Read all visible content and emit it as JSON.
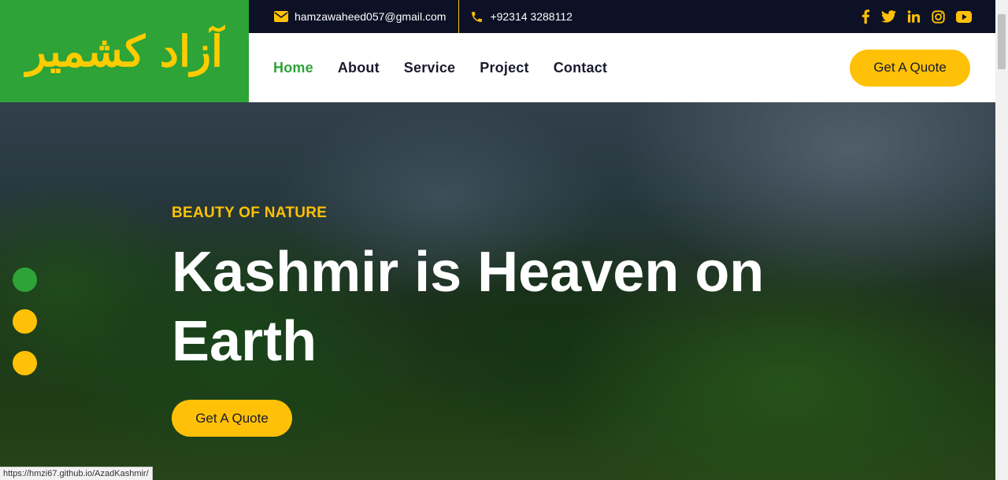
{
  "logo": {
    "text": "آزاد کشمیر"
  },
  "topbar": {
    "email": "hamzawaheed057@gmail.com",
    "phone": "+92314 3288112",
    "socials": [
      "facebook-icon",
      "twitter-icon",
      "linkedin-icon",
      "instagram-icon",
      "youtube-icon"
    ]
  },
  "nav": {
    "items": [
      {
        "label": "Home",
        "active": true
      },
      {
        "label": "About"
      },
      {
        "label": "Service"
      },
      {
        "label": "Project"
      },
      {
        "label": "Contact"
      }
    ],
    "quote_button": "Get A Quote"
  },
  "hero": {
    "kicker": "BEAUTY OF NATURE",
    "title": "Kashmir is Heaven on Earth",
    "quote_button": "Get A Quote"
  },
  "carousel": {
    "slide_count": 3,
    "active_index": 0
  },
  "status_bar": {
    "url": "https://hmzi67.github.io/AzadKashmir/"
  },
  "colors": {
    "accent_yellow": "#ffc107",
    "brand_green": "#2ea337",
    "topbar_dark": "#0d1126"
  }
}
